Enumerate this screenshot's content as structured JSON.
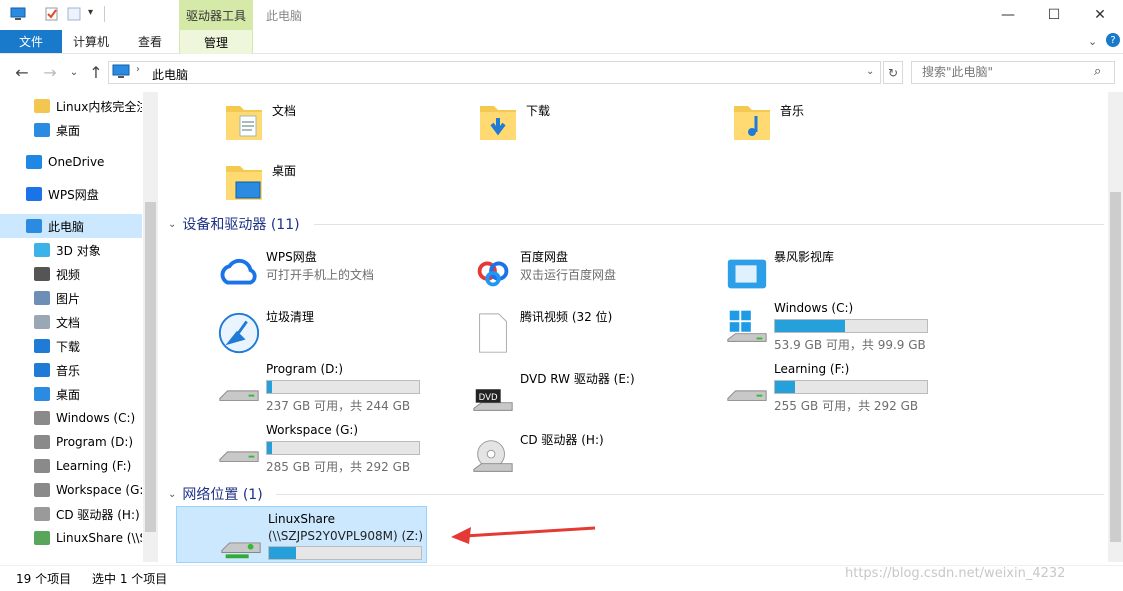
{
  "window": {
    "title": "此电脑",
    "context_tab": "驱动器工具",
    "context_subtab": "管理",
    "controls": {
      "minimize": "—",
      "maximize": "☐",
      "close": "✕"
    }
  },
  "ribbon": {
    "tabs": [
      "文件",
      "计算机",
      "查看"
    ]
  },
  "address": {
    "path": "此电脑",
    "search_placeholder": "搜索\"此电脑\""
  },
  "nav": {
    "items": [
      {
        "label": "Linux内核完全注",
        "icon": "folder-icon"
      },
      {
        "label": "桌面",
        "icon": "desktop-icon"
      },
      {
        "label": "OneDrive",
        "icon": "onedrive-icon"
      },
      {
        "label": "WPS网盘",
        "icon": "cloud-icon"
      },
      {
        "label": "此电脑",
        "icon": "computer-icon"
      },
      {
        "label": "3D 对象",
        "icon": "cube-icon"
      },
      {
        "label": "视频",
        "icon": "video-icon"
      },
      {
        "label": "图片",
        "icon": "picture-icon"
      },
      {
        "label": "文档",
        "icon": "document-icon"
      },
      {
        "label": "下载",
        "icon": "download-icon"
      },
      {
        "label": "音乐",
        "icon": "music-icon"
      },
      {
        "label": "桌面",
        "icon": "desktop-icon"
      },
      {
        "label": "Windows (C:)",
        "icon": "drive-icon"
      },
      {
        "label": "Program (D:)",
        "icon": "drive-icon"
      },
      {
        "label": "Learning (F:)",
        "icon": "drive-icon"
      },
      {
        "label": "Workspace (G:",
        "icon": "drive-icon"
      },
      {
        "label": "CD 驱动器 (H:)",
        "icon": "cd-drive-icon"
      },
      {
        "label": "LinuxShare (\\\\S",
        "icon": "network-drive-icon"
      }
    ]
  },
  "folders": [
    {
      "label": "文档",
      "icon": "documents-folder-icon"
    },
    {
      "label": "下载",
      "icon": "downloads-folder-icon"
    },
    {
      "label": "音乐",
      "icon": "music-folder-icon"
    },
    {
      "label": "桌面",
      "icon": "desktop-folder-icon"
    }
  ],
  "devices": {
    "header": "设备和驱动器 (11)",
    "items": [
      {
        "name": "WPS网盘",
        "sub": "可打开手机上的文档",
        "icon": "wps-cloud-icon"
      },
      {
        "name": "百度网盘",
        "sub": "双击运行百度网盘",
        "icon": "baidu-netdisk-icon"
      },
      {
        "name": "暴风影视库",
        "sub": "",
        "icon": "media-library-icon"
      },
      {
        "name": "垃圾清理",
        "sub": "",
        "icon": "cleanup-broom-icon"
      },
      {
        "name": "腾讯视频 (32 位)",
        "sub": "",
        "icon": "blank-file-icon"
      },
      {
        "name": "Windows (C:)",
        "sub": "53.9 GB 可用，共 99.9 GB",
        "usage": 0.46,
        "icon": "windows-drive-icon"
      },
      {
        "name": "Program (D:)",
        "sub": "237 GB 可用，共 244 GB",
        "usage": 0.03,
        "icon": "drive-icon"
      },
      {
        "name": "DVD RW 驱动器 (E:)",
        "sub": "",
        "icon": "dvd-drive-icon"
      },
      {
        "name": "Learning (F:)",
        "sub": "255 GB 可用，共 292 GB",
        "usage": 0.13,
        "icon": "drive-icon"
      },
      {
        "name": "Workspace (G:)",
        "sub": "285 GB 可用，共 292 GB",
        "usage": 0.03,
        "icon": "drive-icon"
      },
      {
        "name": "CD 驱动器 (H:)",
        "sub": "",
        "icon": "cd-drive-icon"
      }
    ]
  },
  "network": {
    "header": "网络位置 (1)",
    "items": [
      {
        "name": "LinuxShare",
        "sub": "(\\\\SZJPS2Y0VPL908M) (Z:)",
        "usage": 0.18,
        "icon": "network-drive-icon"
      }
    ]
  },
  "status": {
    "count": "19 个项目",
    "selected": "选中 1 个项目"
  },
  "watermark": "https://blog.csdn.net/weixin_4232",
  "colors": {
    "accent": "#1979ca",
    "bar_fill": "#26a0da",
    "header_text": "#1e3287",
    "annotation_arrow": "#e53935"
  }
}
